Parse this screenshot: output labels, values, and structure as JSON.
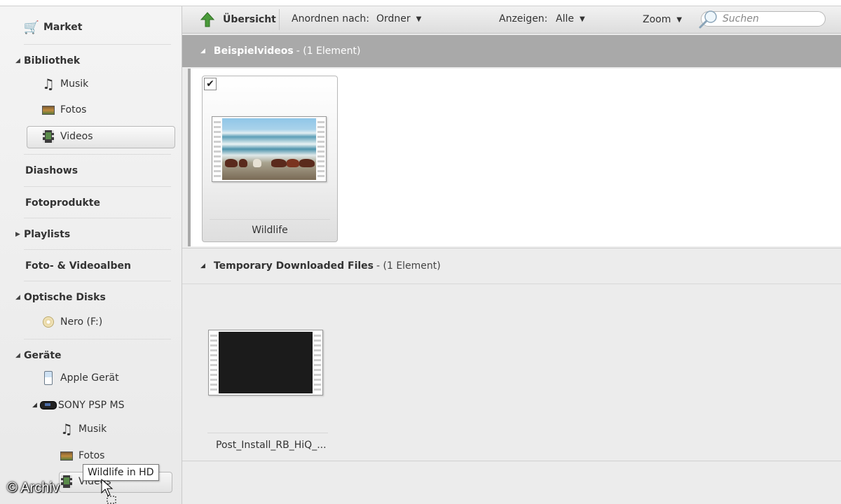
{
  "sidebar": {
    "market": "Market",
    "library": {
      "header": "Bibliothek",
      "items": [
        "Musik",
        "Fotos",
        "Videos"
      ]
    },
    "slideshows": "Diashows",
    "photo_products": "Fotoprodukte",
    "playlists": "Playlists",
    "albums": "Foto- & Videoalben",
    "optical": {
      "header": "Optische Disks",
      "items": [
        "Nero (F:)"
      ]
    },
    "devices": {
      "header": "Geräte",
      "apple": "Apple Gerät",
      "sony": "SONY PSP MS",
      "sony_items": [
        "Musik",
        "Fotos",
        "Videos"
      ]
    }
  },
  "toolbar": {
    "overview": "Übersicht",
    "arrange_label": "Anordnen nach:",
    "arrange_value": "Ordner",
    "show_label": "Anzeigen:",
    "show_value": "Alle",
    "zoom": "Zoom",
    "search_placeholder": "Suchen"
  },
  "groups": [
    {
      "title": "Beispielvideos",
      "count": "- (1 Element)",
      "items": [
        {
          "label": "Wildlife",
          "checked": true
        }
      ]
    },
    {
      "title": "Temporary Downloaded Files",
      "count": "- (1 Element)",
      "items": [
        {
          "label": "Post_Install_RB_HiQ_..."
        }
      ]
    }
  ],
  "drag_tooltip": "Wildlife in HD",
  "watermark": "© Archiv",
  "colors": {
    "group_header": "#a9a9a9",
    "accent_arrow": "#4a9a3a"
  }
}
